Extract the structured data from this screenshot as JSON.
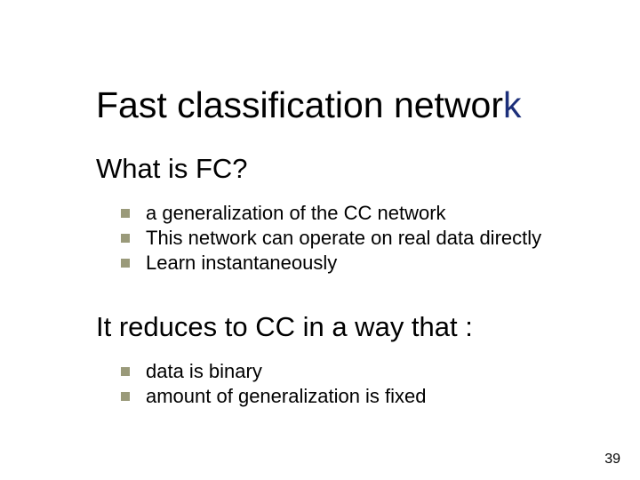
{
  "title_main": "Fast classification networ",
  "title_accent": "k",
  "section1": {
    "heading": "What is FC?",
    "items": [
      "a generalization of the CC network",
      "This network can operate on real data directly",
      "Learn instantaneously"
    ]
  },
  "section2": {
    "heading": "It reduces to CC in a way that :",
    "items": [
      "data is binary",
      "amount of generalization is fixed"
    ]
  },
  "page_number": "39"
}
